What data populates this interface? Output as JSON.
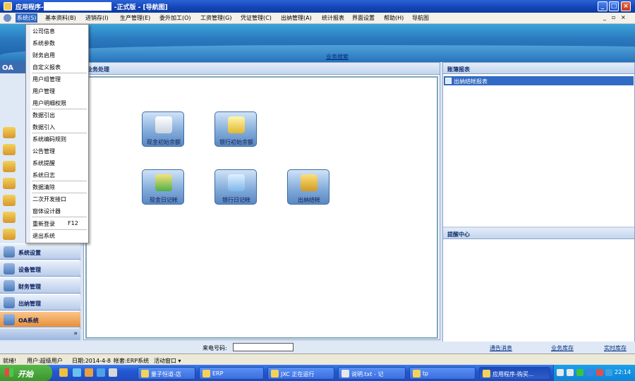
{
  "window": {
    "title_prefix": "应用程序-",
    "title_suffix": "-正式版 - [导航图]",
    "min": "_",
    "max": "□",
    "close": "×"
  },
  "menubar": {
    "items": [
      "系统(S)",
      "基本资料(B)",
      "进销存(I)",
      "生产管理(E)",
      "委外加工(O)",
      "工资管理(G)",
      "凭证管理(C)",
      "出纳管理(A)",
      "统计报表",
      "界面设置",
      "帮助(H)",
      "导航图"
    ],
    "controls": [
      "_",
      "▫",
      "×"
    ]
  },
  "banner": {
    "link": "业务搜索"
  },
  "system_menu": {
    "items": [
      "公司信息",
      "系统参数",
      "财务启用",
      "自定义报表",
      "用户组管理",
      "用户管理",
      "用户明细权限",
      "数据引出",
      "数据引入",
      "系统编码规则",
      "公告管理",
      "系统提醒",
      "系统日志",
      "数据清除",
      "二次开发接口",
      "窗体设计器",
      "重新登录",
      "退出系统"
    ],
    "relogin_shortcut": "F12"
  },
  "left": {
    "header": "OA",
    "nav": [
      "系统设置",
      "设备管理",
      "财务管理",
      "出纳管理",
      "OA系统"
    ],
    "chevron": "»"
  },
  "center": {
    "header": "业务处理",
    "tiles": [
      "现金初始余额",
      "银行初始余额",
      "现金日记帐",
      "银行日记帐",
      "出纳结帐"
    ]
  },
  "right": {
    "header_top": "账簿报表",
    "item": "出纳结帐报表",
    "header_bottom": "提醒中心"
  },
  "bottom": {
    "caller_label": "来电号码:",
    "caller_value": "",
    "links": [
      "通告消息",
      "业务库存",
      "实时库存"
    ]
  },
  "status": {
    "ready": "就绪!",
    "user": "用户:超级用户",
    "date": "日期:2014-4-8",
    "account": "帐套:ERP系统",
    "active_window": "活动窗口 ▾"
  },
  "taskbar": {
    "start": "开始",
    "tasks": [
      "量子恒道-店",
      "ERP",
      "JXC 正在运行",
      "说明.txt - 记",
      "tp",
      "应用程序-购买..."
    ],
    "clock": "22:14"
  },
  "colors": {
    "accent": "#316ac5",
    "title": "#1646b8",
    "banner": "#2b79bf"
  }
}
